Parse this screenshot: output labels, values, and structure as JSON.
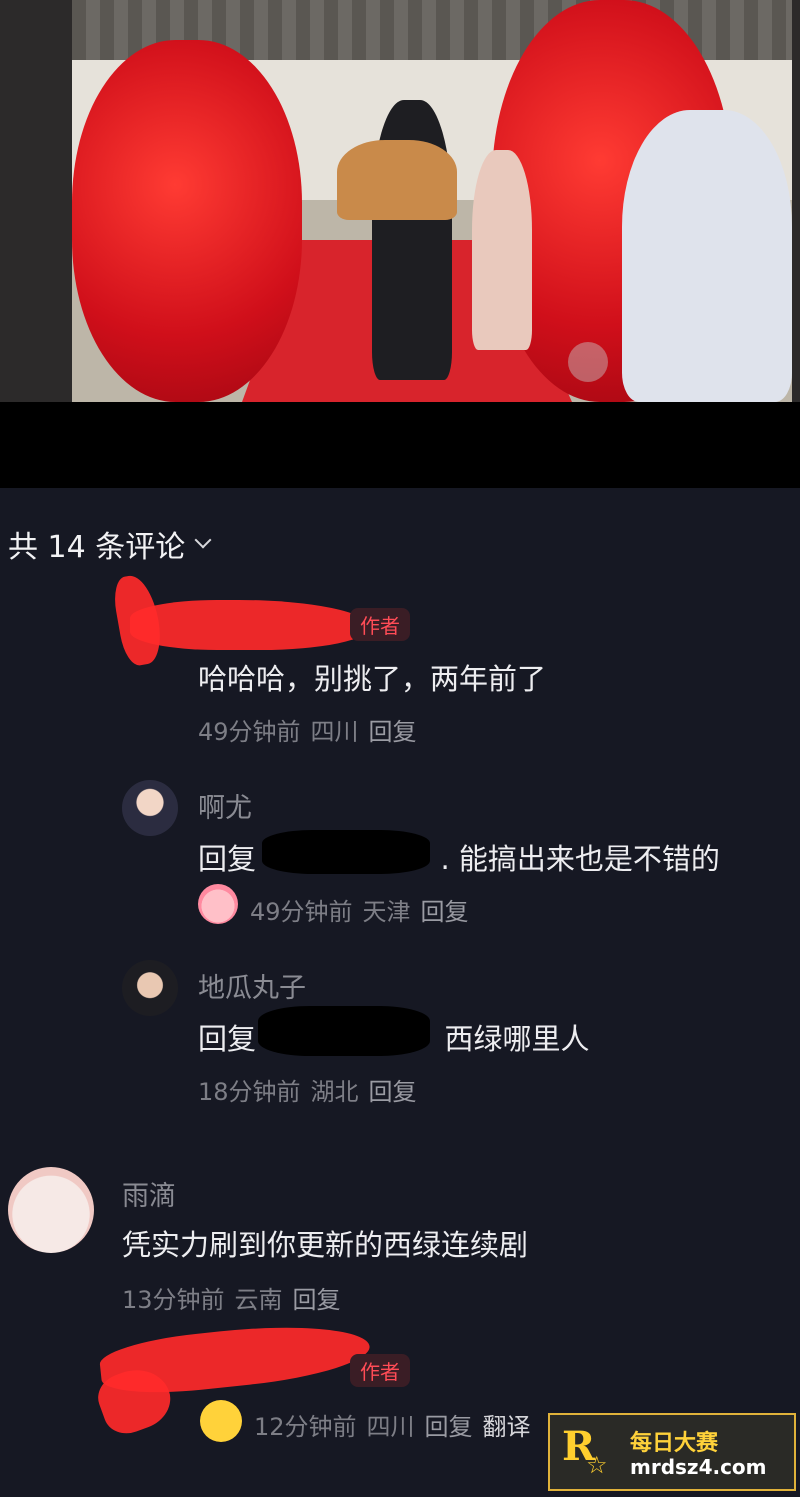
{
  "comments_header": {
    "title": "共 14 条评论"
  },
  "comments": [
    {
      "author_badge": "作者",
      "text": "哈哈哈，别挑了，两年前了",
      "time": "49分钟前",
      "location": "四川",
      "reply_label": "回复"
    },
    {
      "name": "啊尤",
      "text_prefix": "回复",
      "text_suffix": ". 能搞出来也是不错的",
      "time": "49分钟前",
      "location": "天津",
      "reply_label": "回复"
    },
    {
      "name": "地瓜丸子",
      "text_prefix": "回复",
      "text_suffix": "西绿哪里人",
      "time": "18分钟前",
      "location": "湖北",
      "reply_label": "回复"
    },
    {
      "name": "雨滴",
      "text": "凭实力刷到你更新的西绿连续剧",
      "time": "13分钟前",
      "location": "云南",
      "reply_label": "回复"
    },
    {
      "author_badge": "作者",
      "time": "12分钟前",
      "location": "四川",
      "reply_label": "回复",
      "translate_label": "翻译"
    }
  ],
  "watermark": {
    "title": "每日大赛",
    "url": "mrdsz4.com",
    "logo_letter": "R"
  },
  "colors": {
    "background": "#161823",
    "author_badge": "#ff4c56",
    "redaction": "#ff2a2a"
  }
}
